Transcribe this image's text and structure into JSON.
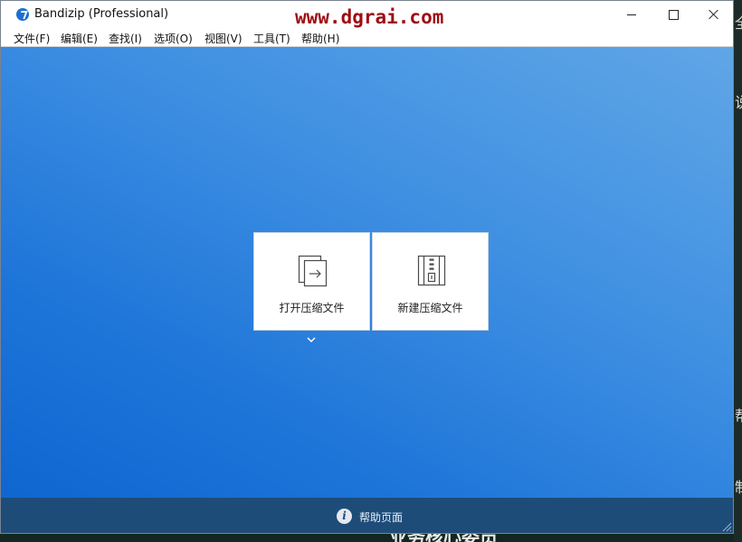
{
  "window": {
    "title": "Bandizip (Professional)",
    "watermark": "www.dgrai.com"
  },
  "menu": [
    {
      "label": "文件(F)"
    },
    {
      "label": "编辑(E)"
    },
    {
      "label": "查找(I)"
    },
    {
      "label": "选项(O)"
    },
    {
      "label": "视图(V)"
    },
    {
      "label": "工具(T)"
    },
    {
      "label": "帮助(H)"
    }
  ],
  "actions": {
    "open_archive": {
      "label": "打开压缩文件",
      "icon": "open-archive-icon"
    },
    "new_archive": {
      "label": "新建压缩文件",
      "icon": "zip-file-icon"
    },
    "more": {
      "icon": "chevron-down-icon"
    }
  },
  "footer": {
    "help_label": "帮助页面",
    "help_icon": "info-icon"
  },
  "desktop": {
    "glyphs": [
      "全",
      "说",
      "帮",
      "制"
    ],
    "bottom_text": "业务核心委员"
  },
  "colors": {
    "accent": "#1f6fce",
    "main_top": "#60a6e6",
    "main_bottom": "#0f66d0",
    "footer_bg": "#1d4c79",
    "watermark": "#9e0d14"
  }
}
